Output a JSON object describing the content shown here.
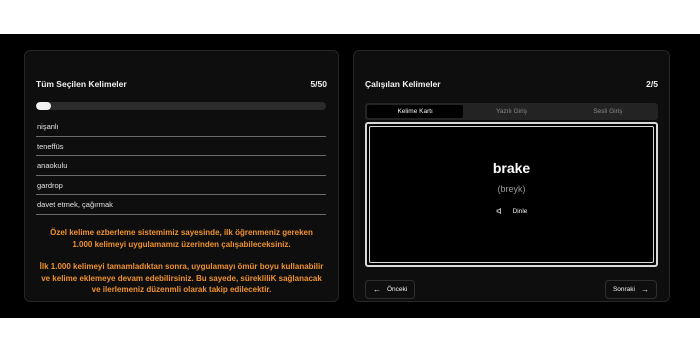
{
  "left_panel": {
    "title": "Tüm Seçilen Kelimeler",
    "counter": "5/50",
    "progress_fraction": 0.05,
    "words": [
      "nişanlı",
      "teneffüs",
      "anaokulu",
      "gardrop",
      "davet etmek, çağırmak"
    ],
    "promo_paragraph_1": "Özel kelime ezberleme sistemimiz sayesinde, ilk öğrenmeniz gereken 1.000 kelimeyi uygulamamız üzerinden çalışabileceksiniz.",
    "promo_paragraph_2": "İlk 1.000 kelimeyi tamamladıktan sonra, uygulamayı ömür boyu kullanabilir ve kelime eklemeye devam edebilirsiniz. Bu sayede, sürekliliK sağlanacak ve ilerlemeniz düzenmli olarak  takip edilecektir."
  },
  "right_panel": {
    "title": "Çalışılan Kelimeler",
    "counter": "2/5",
    "tabs": [
      "Kelime Kartı",
      "Yazılı Giriş",
      "Sesli Giriş"
    ],
    "active_tab": "Kelime Kartı",
    "card": {
      "word": "brake",
      "pronunciation": "(breyk)",
      "listen_label": "Dinle",
      "listen_icon": "speaker-icon"
    },
    "prev_label": "Önceki",
    "next_label": "Sonraki"
  },
  "colors": {
    "background": "#000000",
    "panel": "#0e0e0e",
    "accent_orange": "#f0922e"
  }
}
